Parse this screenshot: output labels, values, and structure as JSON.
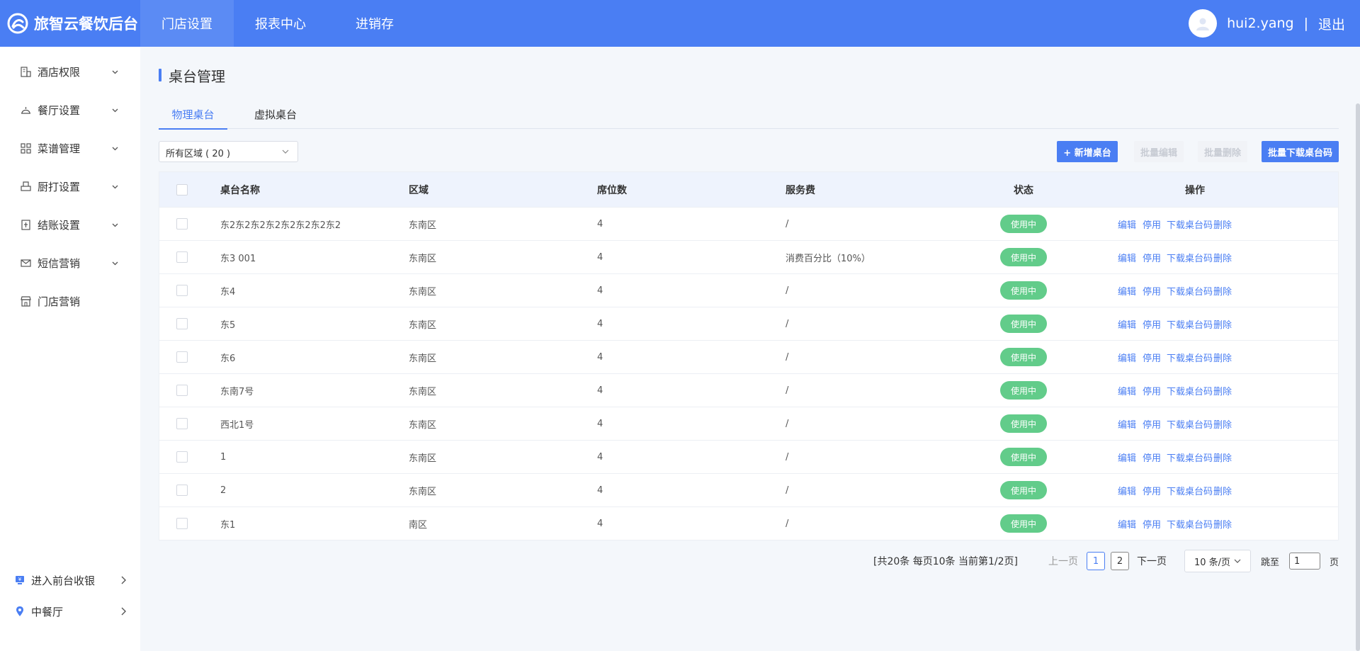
{
  "header": {
    "brand": "旅智云餐饮后台",
    "nav": [
      "门店设置",
      "报表中心",
      "进销存"
    ],
    "user": "hui2.yang",
    "separator": "|",
    "logout": "退出",
    "color": "#4a7ef3"
  },
  "sidebar": {
    "items": [
      {
        "label": "酒店权限",
        "icon": "hotel-icon"
      },
      {
        "label": "餐厅设置",
        "icon": "bell-icon"
      },
      {
        "label": "菜谱管理",
        "icon": "grid-icon"
      },
      {
        "label": "厨打设置",
        "icon": "printer-icon"
      },
      {
        "label": "结账设置",
        "icon": "bill-icon"
      },
      {
        "label": "短信营销",
        "icon": "mail-icon"
      },
      {
        "label": "门店营销",
        "icon": "store-icon"
      }
    ],
    "bottom": [
      {
        "label": "进入前台收银",
        "icon": "cashier-icon"
      },
      {
        "label": "中餐厅",
        "icon": "location-icon"
      }
    ]
  },
  "page": {
    "title": "桌台管理",
    "tabs": [
      "物理桌台",
      "虚拟桌台"
    ],
    "area_select": "所有区域 ( 20 )",
    "buttons": {
      "add": "+ 新增桌台",
      "batch_edit": "批量编辑",
      "batch_delete": "批量删除",
      "batch_download": "批量下载桌台码"
    }
  },
  "table": {
    "columns": [
      "桌台名称",
      "区域",
      "席位数",
      "服务费",
      "状态",
      "操作"
    ],
    "actions": [
      "编辑",
      "停用",
      "下载桌台码",
      "删除"
    ],
    "rows": [
      {
        "name": "东2东2东2东2东2东2东2东2",
        "area": "东南区",
        "seats": "4",
        "fee": "/",
        "status": "使用中"
      },
      {
        "name": "东3 001",
        "area": "东南区",
        "seats": "4",
        "fee": "消费百分比（10%）",
        "status": "使用中"
      },
      {
        "name": "东4",
        "area": "东南区",
        "seats": "4",
        "fee": "/",
        "status": "使用中"
      },
      {
        "name": "东5",
        "area": "东南区",
        "seats": "4",
        "fee": "/",
        "status": "使用中"
      },
      {
        "name": "东6",
        "area": "东南区",
        "seats": "4",
        "fee": "/",
        "status": "使用中"
      },
      {
        "name": "东南7号",
        "area": "东南区",
        "seats": "4",
        "fee": "/",
        "status": "使用中"
      },
      {
        "name": "西北1号",
        "area": "东南区",
        "seats": "4",
        "fee": "/",
        "status": "使用中"
      },
      {
        "name": "1",
        "area": "东南区",
        "seats": "4",
        "fee": "/",
        "status": "使用中"
      },
      {
        "name": "2",
        "area": "东南区",
        "seats": "4",
        "fee": "/",
        "status": "使用中"
      },
      {
        "name": "东1",
        "area": "南区",
        "seats": "4",
        "fee": "/",
        "status": "使用中"
      }
    ]
  },
  "pagination": {
    "summary": "[共20条 每页10条 当前第1/2页]",
    "prev": "上一页",
    "pages": [
      "1",
      "2"
    ],
    "next": "下一页",
    "page_size": "10 条/页",
    "jump_label": "跳至",
    "jump_value": "1",
    "jump_suffix": "页"
  }
}
